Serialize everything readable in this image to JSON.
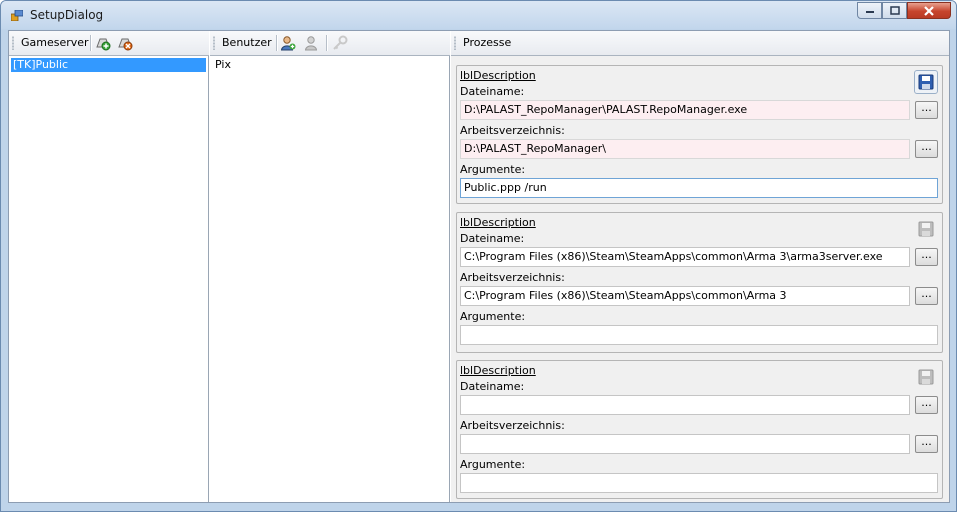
{
  "window": {
    "title": "SetupDialog"
  },
  "gameserver": {
    "toolbar_label": "Gameserver",
    "items": [
      "[TK]Public"
    ],
    "selected_index": 0,
    "icons": [
      "add-gameserver-icon",
      "remove-gameserver-icon"
    ]
  },
  "users": {
    "toolbar_label": "Benutzer",
    "items": [
      "Pix"
    ],
    "icons": [
      "add-user-icon",
      "remove-user-icon",
      "key-icon"
    ]
  },
  "processes": {
    "toolbar_label": "Prozesse",
    "groups": [
      {
        "description": "lblDescription",
        "filename_label": "Dateiname:",
        "filename": "D:\\PALAST_RepoManager\\PALAST.RepoManager.exe",
        "workdir_label": "Arbeitsverzeichnis:",
        "workdir": "D:\\PALAST_RepoManager\\",
        "args_label": "Argumente:",
        "args": "Public.ppp /run",
        "browse_label": "...",
        "save_enabled": true
      },
      {
        "description": "lblDescription",
        "filename_label": "Dateiname:",
        "filename": "C:\\Program Files (x86)\\Steam\\SteamApps\\common\\Arma 3\\arma3server.exe",
        "workdir_label": "Arbeitsverzeichnis:",
        "workdir": "C:\\Program Files (x86)\\Steam\\SteamApps\\common\\Arma 3",
        "args_label": "Argumente:",
        "args": "",
        "browse_label": "...",
        "save_enabled": false
      },
      {
        "description": "lblDescription",
        "filename_label": "Dateiname:",
        "filename": "",
        "workdir_label": "Arbeitsverzeichnis:",
        "workdir": "",
        "args_label": "Argumente:",
        "args": "",
        "browse_label": "...",
        "save_enabled": false
      }
    ]
  }
}
